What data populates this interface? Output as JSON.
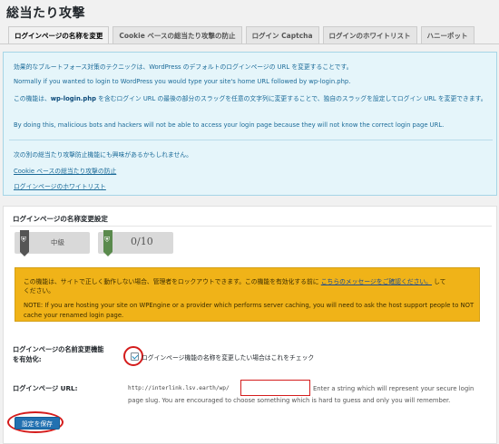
{
  "page": {
    "title": "総当たり攻撃"
  },
  "tabs": [
    {
      "label": "ログインページの名称を変更",
      "active": true
    },
    {
      "label": "Cookie ベースの総当たり攻撃の防止",
      "active": false
    },
    {
      "label": "ログイン Captcha",
      "active": false
    },
    {
      "label": "ログインのホワイトリスト",
      "active": false
    },
    {
      "label": "ハニーポット",
      "active": false
    }
  ],
  "info": {
    "line1": "効果的なブルートフォース対策のテクニックは、WordPress のデフォルトのログインページの URL を変更することです。",
    "line2": "Normally if you wanted to login to WordPress you would type your site's home URL followed by wp-login.php.",
    "line3_a": "この機能は、",
    "line3_b": "wp-login.php",
    "line3_c": " を含むログイン URL の最後の部分のスラッグを任意の文字列に変更することで、独自のスラッグを設定してログイン URL を変更できます。",
    "line4": "By doing this, malicious bots and hackers will not be able to access your login page because they will not know the correct login page URL.",
    "line5": "次の別の総当たり攻撃防止機能にも興味があるかもしれません。",
    "link1": "Cookie ベースの総当たり攻撃の防止",
    "link2": "ログインページのホワイトリスト"
  },
  "panel": {
    "title": "ログインページの名称変更設定",
    "badge_level": "中級",
    "badge_score": "0/10",
    "warning": {
      "line1_a": "この機能は、サイトで正しく動作しない場合、管理者をロックアウトできます。この機能を有効化する前に",
      "line1_link": "こちらのメッセージをご確認ください。",
      "line1_b": "して",
      "line2": "ください。",
      "line3": "NOTE: If you are hosting your site on WPEngine or a provider which performs server caching, you will need to ask the host support people to NOT",
      "line4": "cache your renamed login page."
    },
    "enable_label_1": "ログインページの名前変更機能",
    "enable_label_2": "を有効化:",
    "enable_checked": true,
    "enable_desc": "ログインページ機能の名称を変更したい場合はこれをチェック",
    "url_label": "ログインページ URL:",
    "url_prefix": "http://interlink.lsv.earth/wp/",
    "url_value": "",
    "help1": "Enter a string which will represent your secure login",
    "help2": "page slug. You are encouraged to choose something which is hard to guess and only you will remember.",
    "save_label": "設定を保存"
  },
  "colors": {
    "accent": "#2271b1",
    "highlight": "#d41c1c",
    "warning": "#f0b318"
  }
}
